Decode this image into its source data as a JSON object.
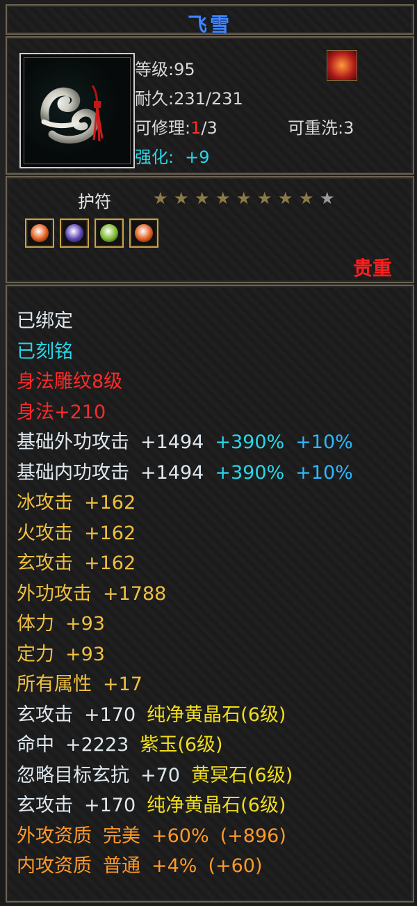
{
  "item": {
    "name": "飞雪",
    "type": "护符",
    "rarity": "贵重",
    "stars_filled": 8,
    "stars_total": 9,
    "stats": {
      "level_label": "等级:",
      "level_value": "95",
      "durability_label": "耐久:",
      "durability_value": "231/231",
      "repairable_label": "可修理:",
      "repairable_used": "1",
      "repairable_total": "/3",
      "rewash_label": "可重洗:",
      "rewash_value": "3",
      "enhance_label": "强化:",
      "enhance_value": "+9"
    },
    "gems": [
      {
        "name": "orange-gem-icon",
        "color": "#e05a1a"
      },
      {
        "name": "purple-gem-icon",
        "color": "#5b3fb2"
      },
      {
        "name": "green-gem-icon",
        "color": "#7bb72a"
      },
      {
        "name": "orange-gem-icon",
        "color": "#e05a1a"
      }
    ],
    "lines": [
      {
        "parts": [
          {
            "t": "已绑定",
            "c": "c-white"
          }
        ]
      },
      {
        "parts": [
          {
            "t": "已刻铭",
            "c": "c-cyan"
          }
        ]
      },
      {
        "parts": [
          {
            "t": "身法雕纹8级",
            "c": "c-red"
          }
        ]
      },
      {
        "parts": [
          {
            "t": "身法+210",
            "c": "c-red"
          }
        ]
      },
      {
        "parts": [
          {
            "t": "基础外功攻击",
            "c": "c-white"
          },
          {
            "t": "+1494",
            "c": "c-white"
          },
          {
            "t": "+390%",
            "c": "c-cyan"
          },
          {
            "t": "+10%",
            "c": "c-blue"
          }
        ]
      },
      {
        "parts": [
          {
            "t": "基础内功攻击",
            "c": "c-white"
          },
          {
            "t": "+1494",
            "c": "c-white"
          },
          {
            "t": "+390%",
            "c": "c-cyan"
          },
          {
            "t": "+10%",
            "c": "c-blue"
          }
        ]
      },
      {
        "parts": [
          {
            "t": "冰攻击",
            "c": "c-gold"
          },
          {
            "t": "+162",
            "c": "c-gold"
          }
        ]
      },
      {
        "parts": [
          {
            "t": "火攻击",
            "c": "c-gold"
          },
          {
            "t": "+162",
            "c": "c-gold"
          }
        ]
      },
      {
        "parts": [
          {
            "t": "玄攻击",
            "c": "c-gold"
          },
          {
            "t": "+162",
            "c": "c-gold"
          }
        ]
      },
      {
        "parts": [
          {
            "t": "外功攻击",
            "c": "c-gold"
          },
          {
            "t": "+1788",
            "c": "c-gold"
          }
        ]
      },
      {
        "parts": [
          {
            "t": "体力",
            "c": "c-gold"
          },
          {
            "t": "+93",
            "c": "c-gold"
          }
        ]
      },
      {
        "parts": [
          {
            "t": "定力",
            "c": "c-gold"
          },
          {
            "t": "+93",
            "c": "c-gold"
          }
        ]
      },
      {
        "parts": [
          {
            "t": "所有属性",
            "c": "c-gold"
          },
          {
            "t": "+17",
            "c": "c-gold"
          }
        ]
      },
      {
        "parts": [
          {
            "t": "玄攻击",
            "c": "c-white"
          },
          {
            "t": "+170",
            "c": "c-white"
          },
          {
            "t": "纯净黄晶石(6级)",
            "c": "c-yellow"
          }
        ]
      },
      {
        "parts": [
          {
            "t": "命中",
            "c": "c-white"
          },
          {
            "t": "+2223",
            "c": "c-white"
          },
          {
            "t": "紫玉(6级)",
            "c": "c-yellow"
          }
        ]
      },
      {
        "parts": [
          {
            "t": "忽略目标玄抗",
            "c": "c-white"
          },
          {
            "t": "+70",
            "c": "c-white"
          },
          {
            "t": "黄冥石(6级)",
            "c": "c-yellow"
          }
        ]
      },
      {
        "parts": [
          {
            "t": "玄攻击",
            "c": "c-white"
          },
          {
            "t": "+170",
            "c": "c-white"
          },
          {
            "t": "纯净黄晶石(6级)",
            "c": "c-yellow"
          }
        ]
      },
      {
        "parts": [
          {
            "t": "外攻资质",
            "c": "c-orange"
          },
          {
            "t": "完美",
            "c": "c-orange"
          },
          {
            "t": "+60%",
            "c": "c-orange"
          },
          {
            "t": "(+896)",
            "c": "c-orange"
          }
        ]
      },
      {
        "parts": [
          {
            "t": "内攻资质",
            "c": "c-orange"
          },
          {
            "t": "普通",
            "c": "c-orange"
          },
          {
            "t": "+4%",
            "c": "c-orange"
          },
          {
            "t": "(+60)",
            "c": "c-orange"
          }
        ]
      }
    ]
  }
}
